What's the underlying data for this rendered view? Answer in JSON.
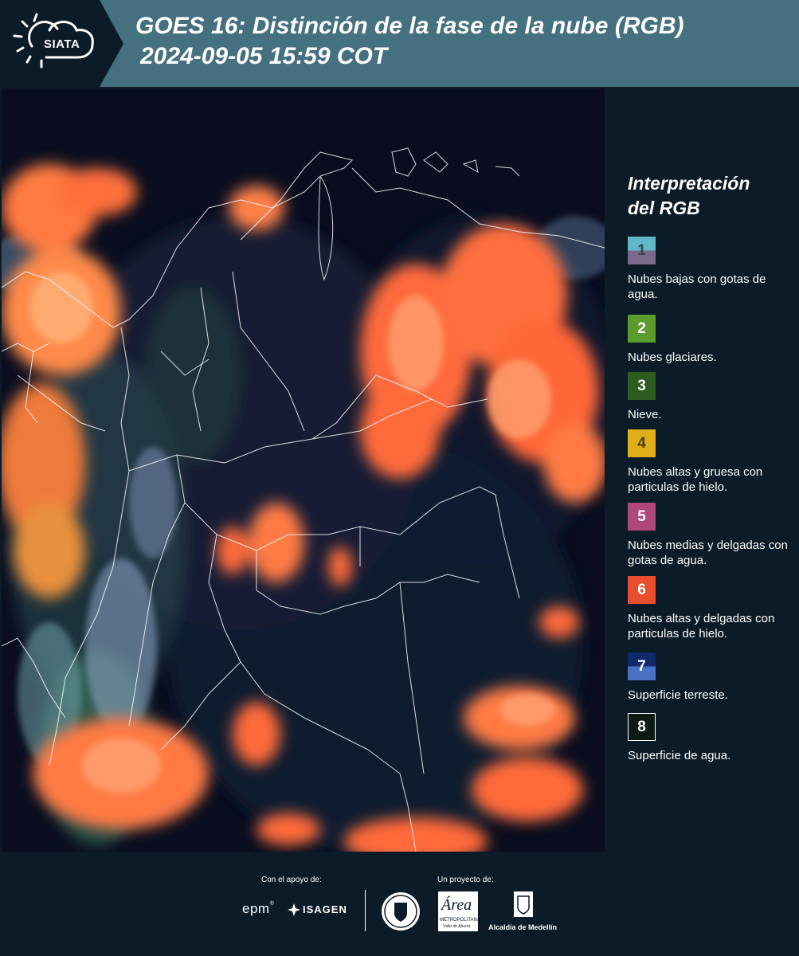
{
  "header": {
    "logo_text": "SIATA",
    "title_line1": "GOES 16: Distinción de la fase de la nube (RGB)",
    "title_line2": "2024-09-05 15:59 COT"
  },
  "legend": {
    "title_line1": "Interpretación",
    "title_line2": "del RGB",
    "items": [
      {
        "number": "1",
        "label": "Nubes bajas con gotas de agua.",
        "color_top": "#5fb7c7",
        "color_bottom": "#7a6b8c",
        "text_color": "#3a3f4a"
      },
      {
        "number": "2",
        "label": "Nubes glaciares.",
        "color_top": "#5a9b2c",
        "color_bottom": "#5a9b2c",
        "text_color": "#ffffff"
      },
      {
        "number": "3",
        "label": "Nieve.",
        "color_top": "#2c5d1e",
        "color_bottom": "#2c5d1e",
        "text_color": "#ffffff"
      },
      {
        "number": "4",
        "label": "Nubes altas y gruesa con particulas de hielo.",
        "color_top": "#e0ae18",
        "color_bottom": "#e0ae18",
        "text_color": "#4a3c10"
      },
      {
        "number": "5",
        "label": "Nubes medias y delgadas con gotas de agua.",
        "color_top": "#b0477a",
        "color_bottom": "#b0477a",
        "text_color": "#ffffff"
      },
      {
        "number": "6",
        "label": "Nubes altas y delgadas con particulas de hielo.",
        "color_top": "#e84e2c",
        "color_bottom": "#e84e2c",
        "text_color": "#ffffff"
      },
      {
        "number": "7",
        "label": "Superficie terreste.",
        "color_top": "#102a6b",
        "color_bottom": "#4a72c4",
        "text_color": "#ffffff"
      },
      {
        "number": "8",
        "label": "Superficie de agua.",
        "color_top": "#0b1a12",
        "color_bottom": "#0b1a12",
        "text_color": "#ffffff"
      }
    ]
  },
  "footer": {
    "support_label": "Con el apoyo de:",
    "project_label": "Un proyecto de:",
    "epm_text": "epm",
    "isagen_text": "ISAGEN",
    "area_text": "Área",
    "area_sub1": "METROPOLITANA",
    "area_sub2": "Valle de Aburrá",
    "alcaldia_text": "Alcaldía de Medellín"
  }
}
